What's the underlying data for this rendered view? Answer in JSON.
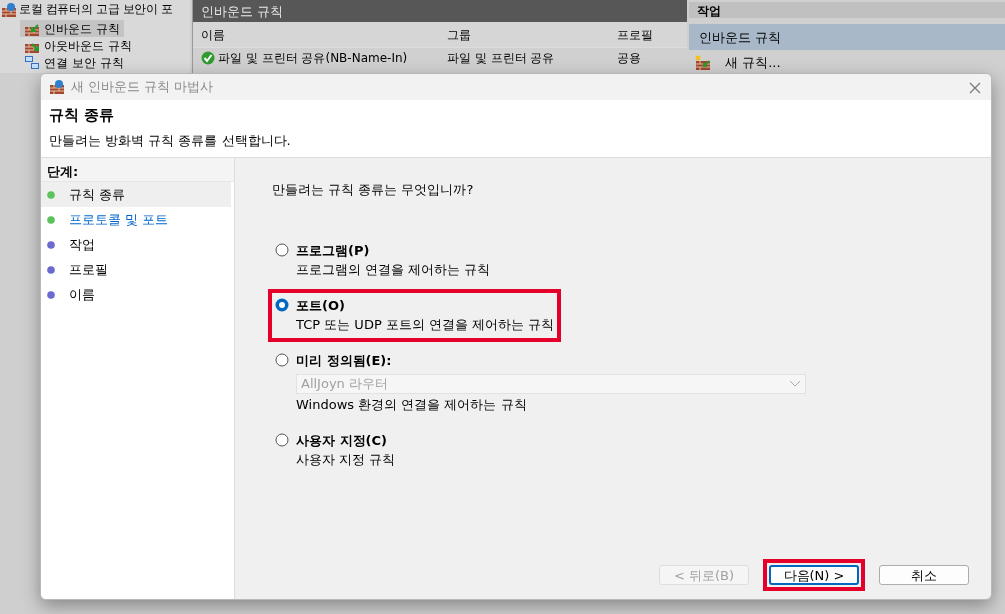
{
  "console": {
    "title": "로컬 컴퓨터의 고급 보안이 포",
    "tree": [
      {
        "label": "인바운드 규칙",
        "selected": true,
        "kind": "inbound"
      },
      {
        "label": "아웃바운드 규칙",
        "selected": false,
        "kind": "outbound"
      },
      {
        "label": "연결 보안 규칙",
        "selected": false,
        "kind": "connection"
      }
    ],
    "rules_panel": {
      "title": "인바운드 규칙",
      "columns": [
        "이름",
        "그룹",
        "프로필"
      ],
      "rows": [
        {
          "enabled": true,
          "cells": [
            "파일 및 프린터 공유(NB-Name-In)",
            "파일 및 프린터 공유",
            "공용"
          ]
        }
      ]
    },
    "actions_panel": {
      "title": "작업",
      "section": "인바운드 규칙",
      "items": [
        {
          "label": "새 규칙..."
        }
      ]
    }
  },
  "dialog": {
    "title": "새 인바운드 규칙 마법사",
    "heading": "규칙 종류",
    "subtitle": "만들려는 방화벽 규칙 종류를 선택합니다.",
    "steps_label": "단계:",
    "steps": [
      {
        "label": "규칙 종류",
        "done": true,
        "selected": true,
        "link": false
      },
      {
        "label": "프로토콜 및 포트",
        "done": true,
        "selected": false,
        "link": true
      },
      {
        "label": "작업",
        "done": false,
        "selected": false,
        "link": false
      },
      {
        "label": "프로필",
        "done": false,
        "selected": false,
        "link": false
      },
      {
        "label": "이름",
        "done": false,
        "selected": false,
        "link": false
      }
    ],
    "question": "만들려는 규칙 종류는 무엇입니까?",
    "options": [
      {
        "label": "프로그램(P)",
        "description": "프로그램의 연결을 제어하는 규칙",
        "selected": false,
        "highlighted": false
      },
      {
        "label": "포트(O)",
        "description": "TCP 또는 UDP 포트의 연결을 제어하는 규칙",
        "selected": true,
        "highlighted": true
      },
      {
        "label": "미리 정의됨(E):",
        "dropdown": {
          "value": "AllJoyn 라우터",
          "disabled": true
        },
        "description": "Windows 환경의 연결을 제어하는 규칙",
        "selected": false,
        "highlighted": false
      },
      {
        "label": "사용자 지정(C)",
        "description": "사용자 지정 규칙",
        "selected": false,
        "highlighted": false
      }
    ],
    "buttons": [
      {
        "label": "< 뒤로(B)",
        "disabled": true,
        "highlighted": false
      },
      {
        "label": "다음(N) >",
        "disabled": false,
        "highlighted": true
      },
      {
        "label": "취소",
        "disabled": false,
        "highlighted": false
      }
    ]
  }
}
